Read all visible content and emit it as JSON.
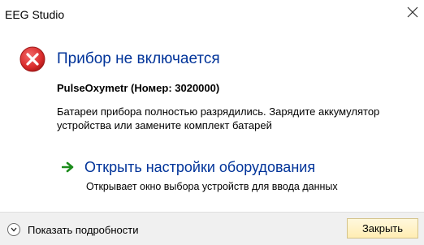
{
  "window": {
    "title": "EEG Studio",
    "close_glyph_icon": "close-icon"
  },
  "dialog": {
    "icon": "error-icon",
    "icon_color": "#d92b2b",
    "main_instruction": "Прибор не включается",
    "device_line": "PulseOxymetr (Номер: 3020000)",
    "content": "Батареи прибора полностью разрядились. Зарядите аккумулятор устройства или замените комплект батарей",
    "accent_color": "#003399"
  },
  "command_link": {
    "icon": "green-arrow-icon",
    "icon_color": "#1c8c1c",
    "title": "Открыть настройки оборудования",
    "description": "Открывает окно выбора устройств для ввода данных"
  },
  "footer": {
    "expand_icon": "chevron-down-icon",
    "expand_label": "Показать подробности",
    "close_button_label": "Закрыть"
  }
}
